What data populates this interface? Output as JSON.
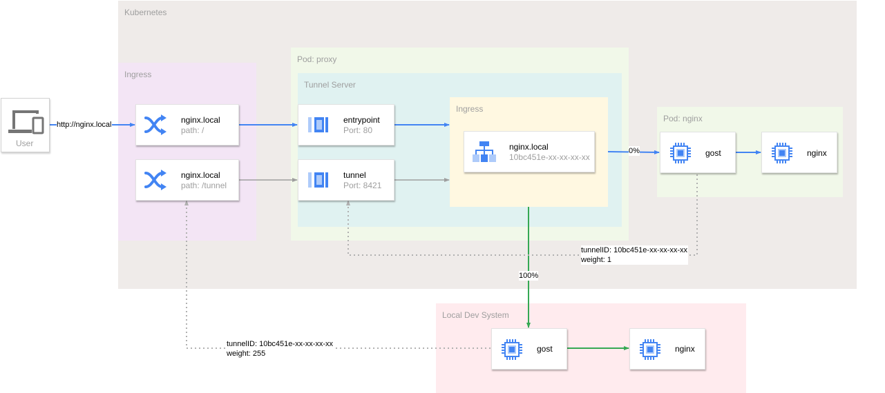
{
  "regions": {
    "kubernetes": "Kubernetes",
    "ingress_outer": "Ingress",
    "pod_proxy": "Pod: proxy",
    "tunnel_server": "Tunnel Server",
    "ingress_inner": "Ingress",
    "pod_nginx": "Pod: nginx",
    "local_dev": "Local Dev System"
  },
  "user": {
    "label": "User"
  },
  "nodes": {
    "ingress_root": {
      "title": "nginx.local",
      "sub": "path: /"
    },
    "ingress_tunnel": {
      "title": "nginx.local",
      "sub": "path: /tunnel"
    },
    "entrypoint": {
      "title": "entrypoint",
      "sub": "Port: 80"
    },
    "tunnel": {
      "title": "tunnel",
      "sub": "Port: 8421"
    },
    "inner_ingress": {
      "title": "nginx.local",
      "sub": "10bc451e-xx-xx-xx-xx"
    },
    "pod_gost": {
      "title": "gost"
    },
    "pod_nginx": {
      "title": "nginx"
    },
    "local_gost": {
      "title": "gost"
    },
    "local_nginx": {
      "title": "nginx"
    }
  },
  "edges": {
    "user_url": "http://nginx.local",
    "zero_percent": "0%",
    "hundred_percent": "100%",
    "pod_tunnel": {
      "line1": "tunnelID: 10bc451e-xx-xx-xx-xx",
      "line2": "weight: 1"
    },
    "local_tunnel": {
      "line1": "tunnelID: 10bc451e-xx-xx-xx-xx",
      "line2": "weight: 255"
    }
  },
  "colors": {
    "blue_edge": "#4284f3",
    "grey_edge": "#9e9e9e",
    "green_edge": "#34a853",
    "dotted_edge": "#b0b0b0",
    "kubernetes_bg": "#efebe9",
    "ingress_bg": "#f3e5f5",
    "pod_bg": "#f1f8e9",
    "tunnel_bg": "#e0f2f1",
    "inner_ingress_bg": "#fff8e1",
    "local_bg": "#ffebee",
    "icon_blue": "#4284f3"
  },
  "icons": {
    "user": "devices-icon",
    "ingress": "shuffle-icon",
    "service": "service-icon",
    "load_balancer": "load-balancer-icon",
    "container": "chip-icon"
  }
}
